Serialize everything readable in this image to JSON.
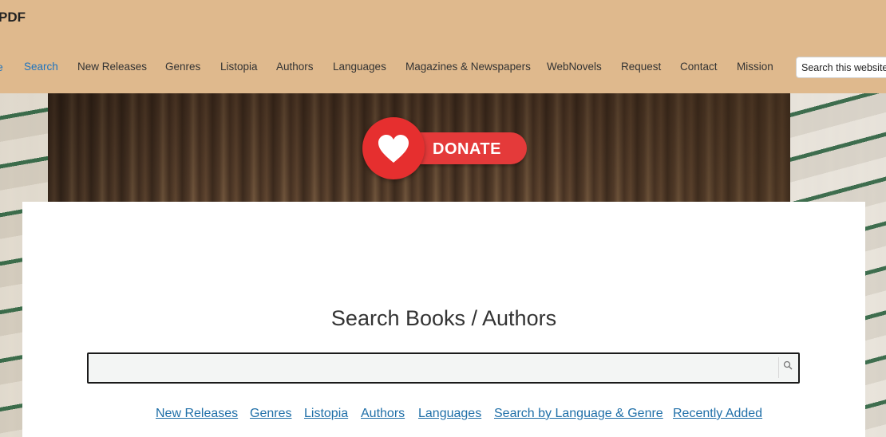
{
  "header": {
    "logo_text": "PDF",
    "nav_prefix": "e",
    "nav": [
      {
        "label": "Search",
        "active": true
      },
      {
        "label": "New Releases"
      },
      {
        "label": "Genres"
      },
      {
        "label": "Listopia"
      },
      {
        "label": "Authors"
      },
      {
        "label": "Languages"
      },
      {
        "label": "Magazines & Newspapers"
      },
      {
        "label": "WebNovels"
      },
      {
        "label": "Request"
      },
      {
        "label": "Contact"
      },
      {
        "label": "Mission"
      }
    ],
    "search_placeholder": "Search this website"
  },
  "donate": {
    "label": "DONATE",
    "icon": "heart-icon",
    "color": "#e43a3a"
  },
  "main": {
    "title": "Search Books / Authors",
    "search_value": "",
    "search_icon": "search-icon",
    "links": [
      "New Releases",
      "Genres",
      "Listopia",
      "Authors",
      "Languages",
      "Search by Language & Genre",
      "Recently Added"
    ]
  },
  "colors": {
    "header_bg": "#dfb98d",
    "nav_active": "#1e73be",
    "link": "#1f6fa8"
  }
}
